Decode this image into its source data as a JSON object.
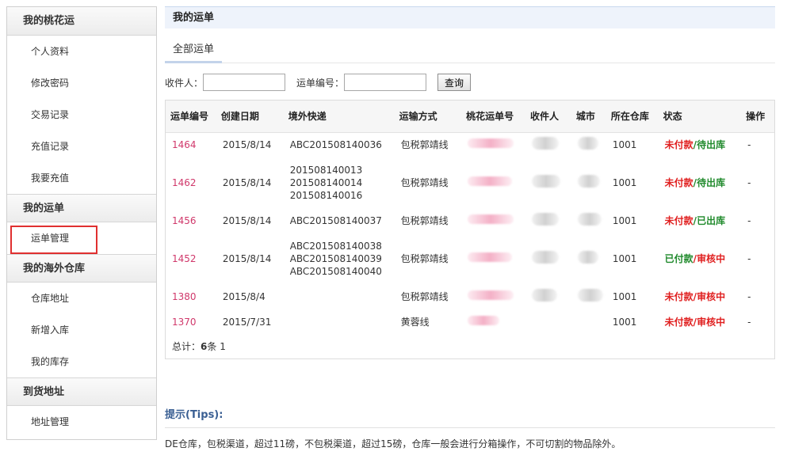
{
  "sidebar": {
    "sections": [
      {
        "title": "我的桃花运",
        "items": [
          "个人资料",
          "修改密码",
          "交易记录",
          "充值记录",
          "我要充值"
        ]
      },
      {
        "title": "我的运单",
        "items": [
          "运单管理"
        ]
      },
      {
        "title": "我的海外仓库",
        "items": [
          "仓库地址",
          "新增入库",
          "我的库存"
        ]
      },
      {
        "title": "到货地址",
        "items": [
          "地址管理"
        ]
      }
    ]
  },
  "main": {
    "title": "我的运单",
    "tab_all": "全部运单",
    "search": {
      "receiver_label": "收件人：",
      "order_no_label": "运单编号：",
      "query_button": "查询"
    },
    "table": {
      "headers": [
        "运单编号",
        "创建日期",
        "境外快递",
        "运输方式",
        "桃花运单号",
        "收件人",
        "城市",
        "所在仓库",
        "状态",
        "操作"
      ],
      "rows": [
        {
          "id": "1464",
          "date": "2015/8/14",
          "express": [
            "ABC201508140036"
          ],
          "method": "包税郭靖线",
          "warehouse": "1001",
          "pay": "未付款",
          "sep": "/",
          "stage": "待出库",
          "op": "-"
        },
        {
          "id": "1462",
          "date": "2015/8/14",
          "express": [
            "201508140013",
            "201508140014",
            "201508140016"
          ],
          "method": "包税郭靖线",
          "warehouse": "1001",
          "pay": "未付款",
          "sep": "/",
          "stage": "待出库",
          "op": "-"
        },
        {
          "id": "1456",
          "date": "2015/8/14",
          "express": [
            "ABC201508140037"
          ],
          "method": "包税郭靖线",
          "warehouse": "1001",
          "pay": "未付款",
          "sep": "/",
          "stage": "已出库",
          "op": "-"
        },
        {
          "id": "1452",
          "date": "2015/8/14",
          "express": [
            "ABC201508140038",
            "ABC201508140039",
            "ABC201508140040"
          ],
          "method": "包税郭靖线",
          "warehouse": "1001",
          "pay": "已付款",
          "sep": "/",
          "stage": "审核中",
          "op": "-"
        },
        {
          "id": "1380",
          "date": "2015/8/4",
          "express": [],
          "method": "包税郭靖线",
          "warehouse": "1001",
          "pay": "未付款",
          "sep": "/",
          "stage": "审核中",
          "op": "-"
        },
        {
          "id": "1370",
          "date": "2015/7/31",
          "express": [],
          "method": "黄蓉线",
          "warehouse": "1001",
          "pay": "未付款",
          "sep": "/",
          "stage": "审核中",
          "op": "-"
        }
      ]
    },
    "total": {
      "prefix": "总计：",
      "count": "6",
      "suffix": "条 1"
    }
  },
  "tips": {
    "title": "提示(Tips):",
    "text": "DE仓库，包税渠道，超过11磅，不包税渠道，超过15磅，仓库一般会进行分箱操作，不可切割的物品除外。"
  },
  "colors": {
    "link": "#d0386b",
    "unpaid": "#e02020",
    "paid": "#208a2c",
    "tips_title": "#3a5f93",
    "highlight_box": "#e03030"
  }
}
